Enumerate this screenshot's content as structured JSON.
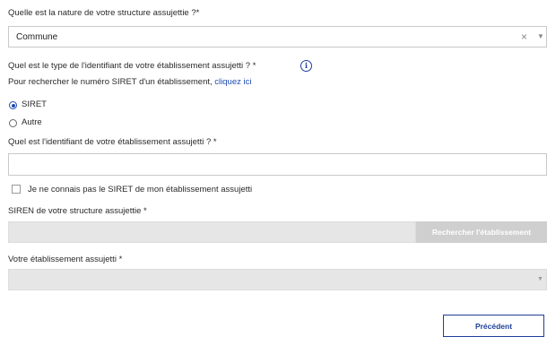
{
  "structure": {
    "label": "Quelle est la nature de votre structure assujettie ?*",
    "value": "Commune",
    "clear_icon": "×",
    "caret_icon": "▼"
  },
  "identifier_type": {
    "label": "Quel est le type de l'identifiant de votre établissement assujetti ? *",
    "info_icon": "i",
    "help_text": "Pour rechercher le numéro SIRET d'un établissement,",
    "help_link": "cliquez ici",
    "options": [
      {
        "label": "SIRET",
        "checked": true
      },
      {
        "label": "Autre",
        "checked": false
      }
    ]
  },
  "identifier": {
    "label": "Quel est l'identifiant de votre établissement assujetti ? *",
    "value": "",
    "checkbox_label": "Je ne connais pas le SIRET de mon établissement assujetti"
  },
  "siren": {
    "label": "SIREN de votre structure assujettie  *",
    "value": "",
    "search_button": "Rechercher l'établissement"
  },
  "establishment": {
    "label": "Votre établissement assujetti  *",
    "caret_icon": "▼"
  },
  "footer": {
    "prev_button": "Précédent"
  }
}
